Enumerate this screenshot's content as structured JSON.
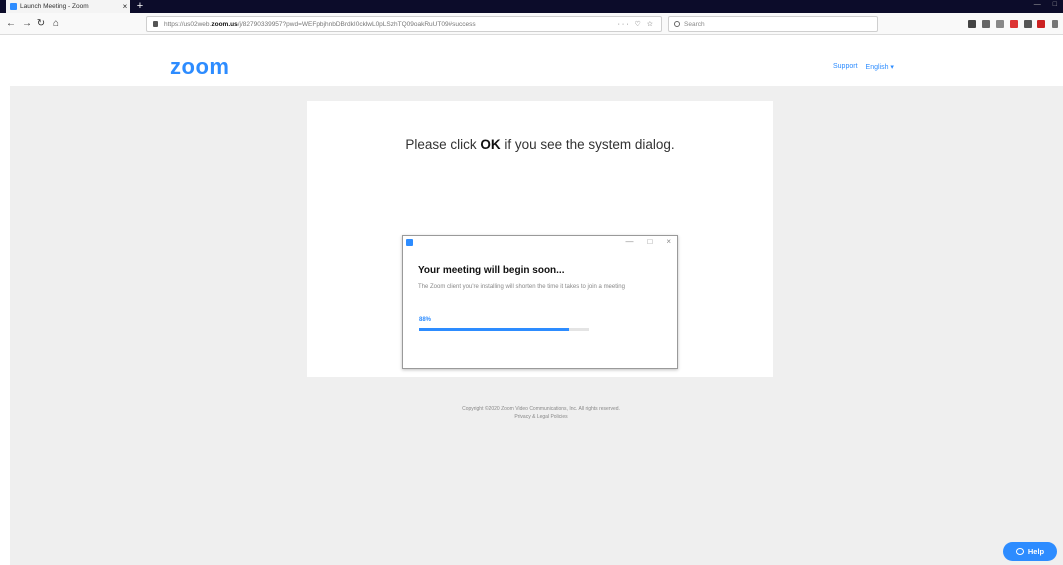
{
  "browser": {
    "tab_title": "Launch Meeting - Zoom",
    "tab_close": "×",
    "new_tab": "+",
    "back": "←",
    "forward": "→",
    "reload": "↻",
    "home": "⌂",
    "url_prefix": "https://us02web.",
    "url_domain": "zoom.us",
    "url_suffix": "/j/82790339957?pwd=WEFpbjhnbDBrdkI0cklwL0pLSzhTQ09oakRuUT09#success",
    "url_actions": "··· ♡ ☆",
    "search_placeholder": "Search",
    "extensions_color_a": "#d33",
    "extensions_color_b": "#c22"
  },
  "header": {
    "logo": "zoom",
    "support_link": "Support",
    "language_link": "English ▾"
  },
  "card": {
    "title_before": "Please click ",
    "title_bold": "OK",
    "title_after": " if you see the system dialog."
  },
  "dialog": {
    "minimize": "—",
    "maximize": "□",
    "close": "×",
    "heading": "Your meeting will begin soon...",
    "text": "The Zoom client you're installing will shorten the time it takes to join a meeting",
    "percent_label": "88%",
    "progress": 0.88
  },
  "footer": {
    "copyright": "Copyright ©2020 Zoom Video Communications, Inc. All rights reserved.",
    "links": "Privacy & Legal Policies"
  },
  "help": {
    "label": "Help"
  },
  "colors": {
    "brand": "#2d8cff",
    "page_bg": "#efefef"
  }
}
